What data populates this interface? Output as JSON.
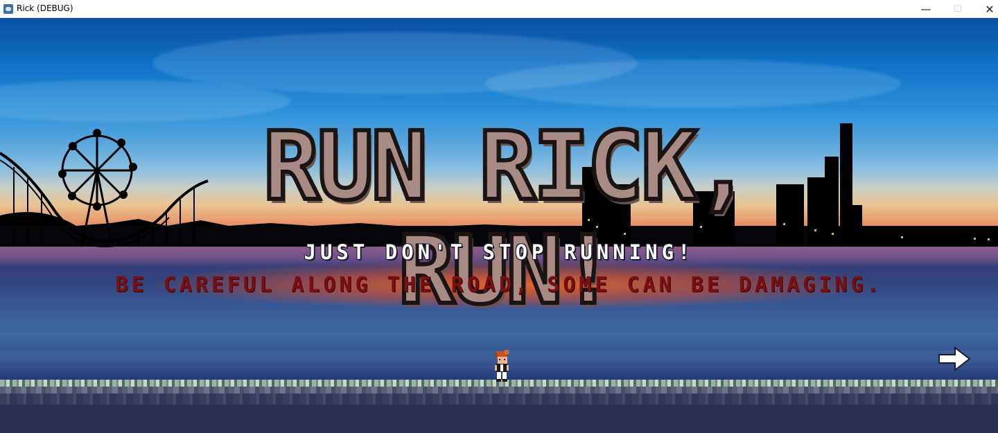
{
  "window": {
    "title": "Rick (DEBUG)",
    "minimize": "—",
    "maximize": "☐",
    "close": "✕"
  },
  "game": {
    "title": "RUN RICK, RUN!",
    "tagline": "JUST DON'T STOP RUNNING!",
    "warning": "BE CAREFUL ALONG THE ROAD, SOME CAN BE DAMAGING."
  },
  "colors": {
    "title_fill": "#a98b85",
    "title_outline": "#1a1414",
    "tagline": "#ffffff",
    "warning": "#7a0f12",
    "ground": "#2b3050"
  },
  "icons": {
    "next": "arrow-right-icon",
    "app": "app-icon",
    "player": "rick-sprite"
  }
}
